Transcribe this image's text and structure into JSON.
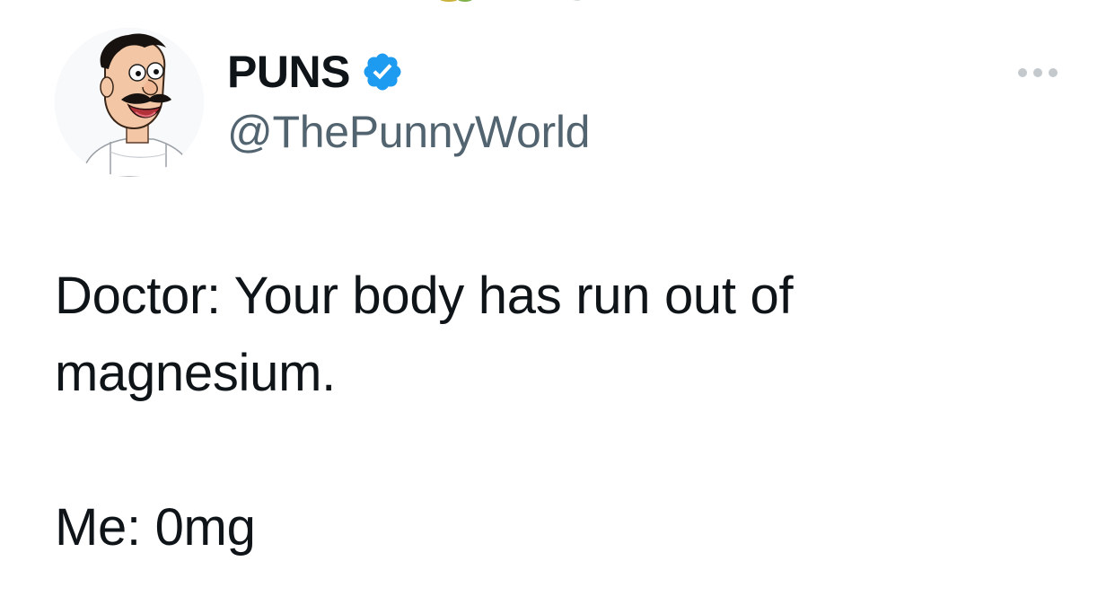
{
  "author": {
    "display_name": "PUNS",
    "handle": "@ThePunnyWorld",
    "verified": true,
    "avatar_icon": "cartoon-man-mustache-avatar"
  },
  "tweet": {
    "lines": [
      "Doctor: Your body has run out of",
      "magnesium.",
      "",
      "Me: 0mg"
    ]
  },
  "icons": {
    "verified": "verified-badge-icon",
    "more": "more-options-icon"
  },
  "colors": {
    "text_primary": "#0f1419",
    "text_secondary": "#536471",
    "verified_blue": "#1d9bf0",
    "background": "#ffffff"
  }
}
